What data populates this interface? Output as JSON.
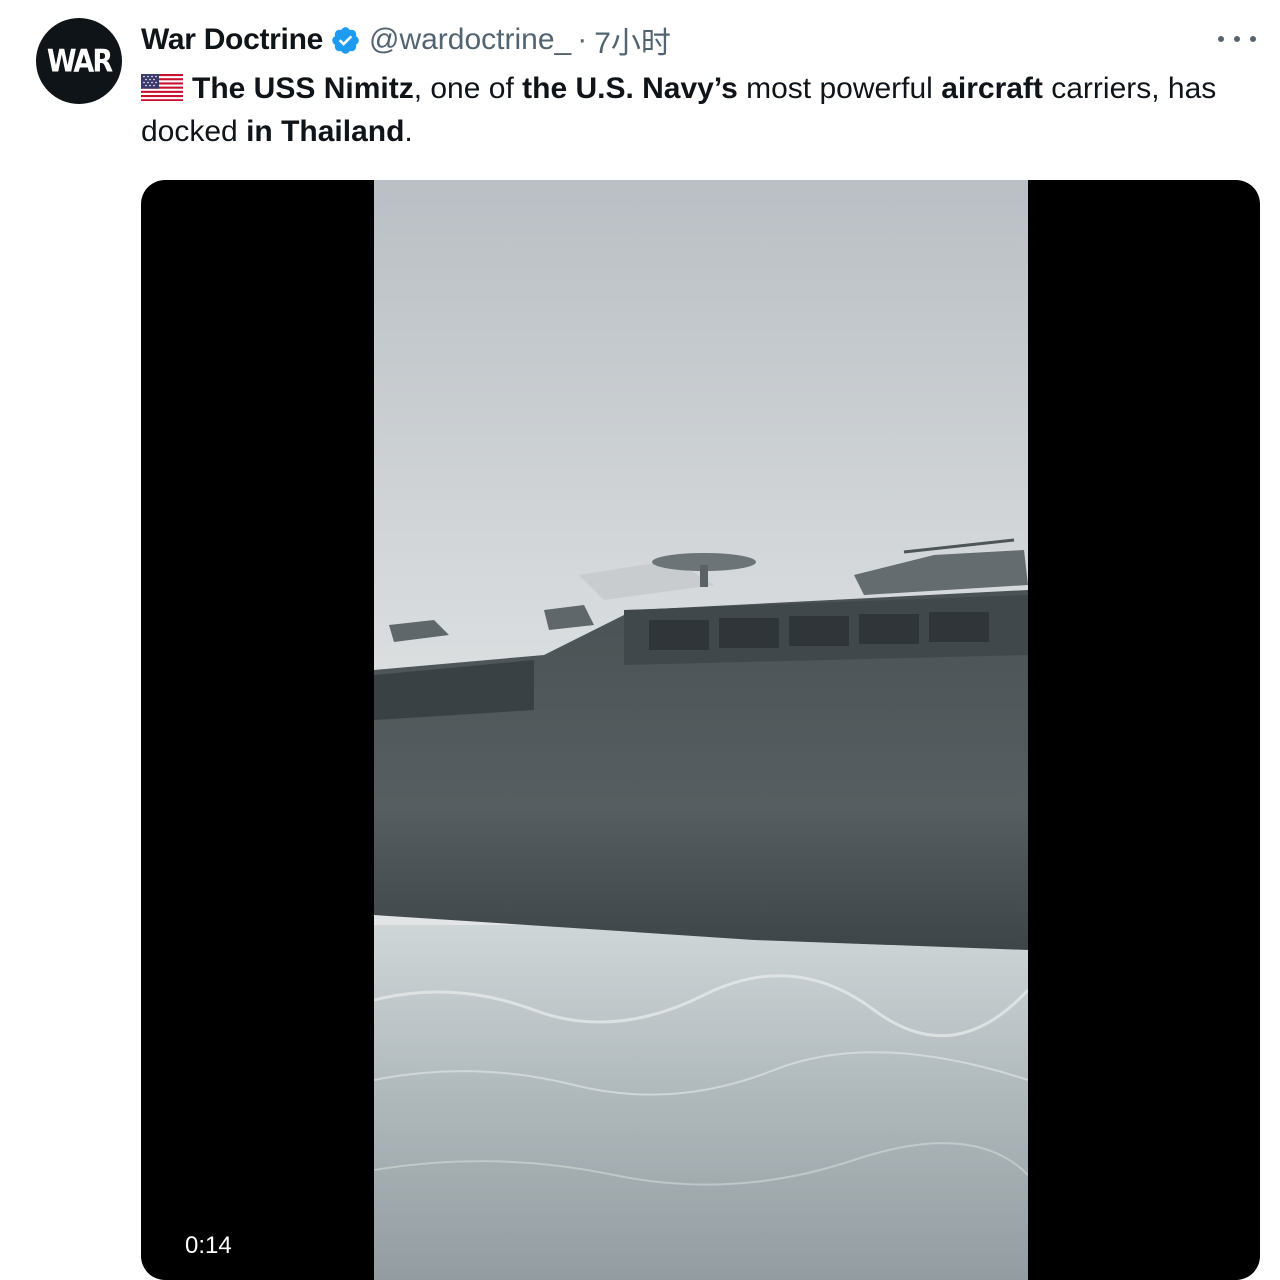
{
  "tweet": {
    "avatar_text": "WAR",
    "author_name": "War Doctrine",
    "handle": "@wardoctrine_",
    "separator": "·",
    "timestamp": "7小时",
    "text_segments": [
      {
        "text": "The USS Nimitz",
        "bold": true
      },
      {
        "text": ", one of ",
        "bold": false
      },
      {
        "text": "the U.S. Navy’s",
        "bold": true
      },
      {
        "text": " most powerful ",
        "bold": false
      },
      {
        "text": "aircraft",
        "bold": true
      },
      {
        "text": " carriers, has docked ",
        "bold": false
      },
      {
        "text": "in Thailand",
        "bold": true
      },
      {
        "text": ".",
        "bold": false
      }
    ],
    "flag_icon": "us-flag-icon",
    "verified_color": "#1d9bf0"
  },
  "media": {
    "type": "video",
    "duration_label": "0:14"
  }
}
